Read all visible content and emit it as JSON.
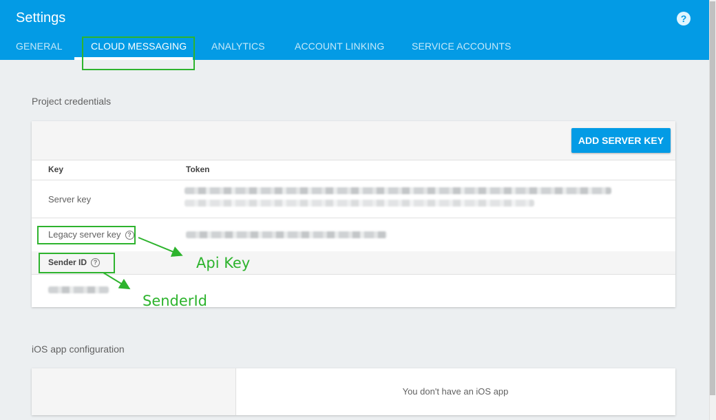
{
  "header": {
    "title": "Settings",
    "help_icon": "question-circle-icon",
    "help_glyph": "?",
    "tabs": [
      {
        "label": "GENERAL"
      },
      {
        "label": "CLOUD MESSAGING"
      },
      {
        "label": "ANALYTICS"
      },
      {
        "label": "ACCOUNT LINKING"
      },
      {
        "label": "SERVICE ACCOUNTS"
      }
    ],
    "active_tab": "CLOUD MESSAGING"
  },
  "credentials": {
    "section_title": "Project credentials",
    "add_button": "ADD SERVER KEY",
    "columns": {
      "key": "Key",
      "token": "Token"
    },
    "rows": [
      {
        "key": "Server key",
        "token_obscured": true
      },
      {
        "key": "Legacy server key",
        "token_obscured": true
      }
    ],
    "sender": {
      "label": "Sender ID",
      "value_obscured": true
    }
  },
  "annotations": {
    "api_key": "Api Key",
    "sender_id": "SenderId"
  },
  "ios": {
    "section_title": "iOS app configuration",
    "empty_message": "You don't have an iOS app"
  },
  "colors": {
    "header_blue": "#039be5",
    "annotation_green": "#2db32d"
  }
}
